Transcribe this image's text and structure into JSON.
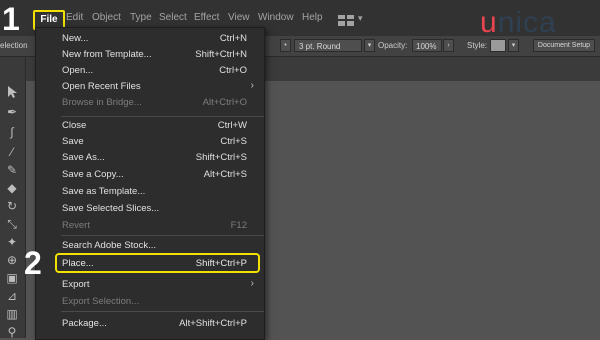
{
  "menubar": {
    "file": "File",
    "items": [
      "Edit",
      "Object",
      "Type",
      "Select",
      "Effect",
      "View",
      "Window",
      "Help"
    ]
  },
  "logo": {
    "text_a": "u",
    "text_b": "nica"
  },
  "controlbar": {
    "selection": "election",
    "stroke_style": "3 pt. Round",
    "opacity_label": "Opacity:",
    "opacity_value": "100%",
    "style_label": "Style:",
    "document_setup": "Document Setup"
  },
  "file_menu": [
    {
      "label": "New...",
      "shortcut": "Ctrl+N"
    },
    {
      "label": "New from Template...",
      "shortcut": "Shift+Ctrl+N"
    },
    {
      "label": "Open...",
      "shortcut": "Ctrl+O"
    },
    {
      "label": "Open Recent Files",
      "submenu": true
    },
    {
      "label": "Browse in Bridge...",
      "shortcut": "Alt+Ctrl+O",
      "disabled": true
    },
    {
      "label": "Close",
      "shortcut": "Ctrl+W"
    },
    {
      "label": "Save",
      "shortcut": "Ctrl+S"
    },
    {
      "label": "Save As...",
      "shortcut": "Shift+Ctrl+S"
    },
    {
      "label": "Save a Copy...",
      "shortcut": "Alt+Ctrl+S"
    },
    {
      "label": "Save as Template..."
    },
    {
      "label": "Save Selected Slices..."
    },
    {
      "label": "Revert",
      "shortcut": "F12",
      "disabled": true
    },
    {
      "label": "Search Adobe Stock..."
    },
    {
      "label": "Place...",
      "shortcut": "Shift+Ctrl+P"
    },
    {
      "label": "Export",
      "submenu": true
    },
    {
      "label": "Export Selection...",
      "disabled": true
    },
    {
      "label": "Package...",
      "shortcut": "Alt+Shift+Ctrl+P"
    }
  ],
  "step_labels": [
    "1",
    "2"
  ],
  "colors": {
    "highlight": "#f1e000",
    "brand_red": "#e8454f",
    "brand_dark": "#2f4052"
  }
}
